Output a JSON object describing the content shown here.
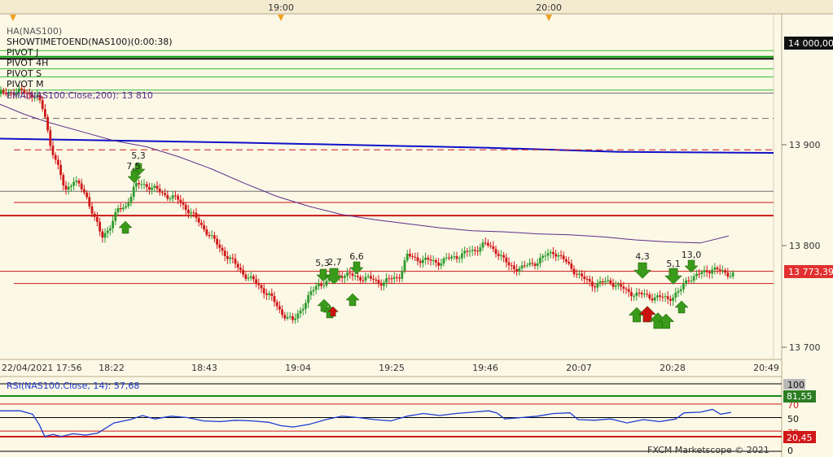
{
  "timebar": {
    "labels": [
      "19:00",
      "20:00"
    ]
  },
  "indicators": {
    "lines": [
      "HA(NAS100)",
      "SHOWTIMETOEND(NAS100)(0:00:38)",
      "PIVOT J",
      "PIVOT 4H",
      "PIVOT S",
      "PIVOT M"
    ],
    "ema_label": "EMA(NAS100.Close,200): 13 810"
  },
  "price_axis": {
    "ticks": [
      "13 900",
      "13 800",
      "13 700"
    ],
    "top_badge": "14 000,00",
    "current_badge": "13 773,39"
  },
  "time_axis": {
    "labels": [
      "22/04/2021 17:56",
      "18:22",
      "18:43",
      "19:04",
      "19:25",
      "19:46",
      "20:07",
      "20:28",
      "20:49"
    ]
  },
  "signals": [
    "5,3",
    "7,5",
    "5,3",
    "2,7",
    "6,6",
    "4,3",
    "5,1",
    "13,0"
  ],
  "rsi": {
    "label": "RSI(NAS100.Close, 14): 57,68",
    "axis_ticks": [
      "100",
      "70",
      "50",
      "30",
      "0"
    ],
    "upper_badge": "81,55",
    "lower_badge": "20,45"
  },
  "footer": {
    "copyright": "FXCM Marketscope © 2021"
  },
  "colors": {
    "background": "#fcf8e6",
    "bull": "#2e9b2e",
    "bear": "#d01818",
    "ema": "#5a2d8a",
    "pivot_blue": "#1010c8",
    "rsi": "#1e3cd2",
    "signal_up": "#3a9a1a",
    "signal_down": "#cc1010"
  },
  "chart_data": {
    "type": "candlestick",
    "symbol": "NAS100",
    "ylim": [
      13697,
      13995
    ],
    "y_ticks": [
      13700,
      13800,
      13900
    ],
    "current_price": 13773.39,
    "ema": {
      "name": "EMA(NAS100.Close,200)",
      "last": 13810,
      "points": [
        [
          0,
          13940
        ],
        [
          30,
          13930
        ],
        [
          60,
          13922
        ],
        [
          100,
          13913
        ],
        [
          140,
          13904
        ],
        [
          180,
          13898
        ],
        [
          220,
          13888
        ],
        [
          260,
          13876
        ],
        [
          300,
          13862
        ],
        [
          340,
          13849
        ],
        [
          380,
          13839
        ],
        [
          420,
          13831
        ],
        [
          460,
          13826
        ],
        [
          500,
          13822
        ],
        [
          540,
          13818
        ],
        [
          580,
          13815
        ],
        [
          620,
          13814
        ],
        [
          660,
          13812
        ],
        [
          700,
          13811
        ],
        [
          740,
          13809
        ],
        [
          780,
          13806
        ],
        [
          820,
          13804
        ],
        [
          860,
          13803
        ],
        [
          895,
          13810
        ]
      ]
    },
    "pivot_levels": [
      {
        "kind": "blue",
        "points": [
          [
            0,
            13906
          ],
          [
            300,
            13902
          ],
          [
            600,
            13897
          ],
          [
            760,
            13893
          ],
          [
            950,
            13892
          ]
        ]
      },
      {
        "kind": "red",
        "value": 13830
      },
      {
        "kind": "red",
        "value": 13843
      },
      {
        "kind": "red",
        "value": 13775
      },
      {
        "kind": "red",
        "value": 13763
      },
      {
        "kind": "red-dashed",
        "value": 13895
      },
      {
        "kind": "gray",
        "value": 13951
      },
      {
        "kind": "gray",
        "value": 13854
      },
      {
        "kind": "gray-dashed",
        "value": 13926
      },
      {
        "kind": "green",
        "value": 13993
      },
      {
        "kind": "green",
        "value": 13985
      },
      {
        "kind": "green",
        "value": 13975
      },
      {
        "kind": "green",
        "value": 13967
      },
      {
        "kind": "green",
        "value": 13954
      }
    ],
    "rsi": {
      "ylim": [
        0,
        100
      ],
      "levels": [
        70,
        50,
        30
      ],
      "last": 57.68,
      "points": [
        [
          0,
          60
        ],
        [
          25,
          60
        ],
        [
          40,
          55
        ],
        [
          48,
          40
        ],
        [
          55,
          22
        ],
        [
          65,
          25
        ],
        [
          75,
          22
        ],
        [
          90,
          26
        ],
        [
          105,
          24
        ],
        [
          120,
          27
        ],
        [
          140,
          42
        ],
        [
          160,
          47
        ],
        [
          175,
          53
        ],
        [
          190,
          48
        ],
        [
          210,
          52
        ],
        [
          230,
          50
        ],
        [
          250,
          45
        ],
        [
          270,
          44
        ],
        [
          290,
          46
        ],
        [
          310,
          45
        ],
        [
          330,
          43
        ],
        [
          345,
          38
        ],
        [
          360,
          36
        ],
        [
          380,
          40
        ],
        [
          400,
          47
        ],
        [
          420,
          52
        ],
        [
          440,
          50
        ],
        [
          460,
          47
        ],
        [
          480,
          45
        ],
        [
          500,
          52
        ],
        [
          520,
          56
        ],
        [
          540,
          53
        ],
        [
          560,
          56
        ],
        [
          580,
          58
        ],
        [
          600,
          60
        ],
        [
          610,
          57
        ],
        [
          620,
          48
        ],
        [
          640,
          50
        ],
        [
          660,
          52
        ],
        [
          680,
          56
        ],
        [
          700,
          57
        ],
        [
          710,
          47
        ],
        [
          730,
          46
        ],
        [
          750,
          48
        ],
        [
          770,
          42
        ],
        [
          790,
          47
        ],
        [
          810,
          44
        ],
        [
          830,
          48
        ],
        [
          840,
          57
        ],
        [
          860,
          58
        ],
        [
          875,
          62
        ],
        [
          885,
          55
        ],
        [
          898,
          57.68
        ]
      ]
    }
  }
}
